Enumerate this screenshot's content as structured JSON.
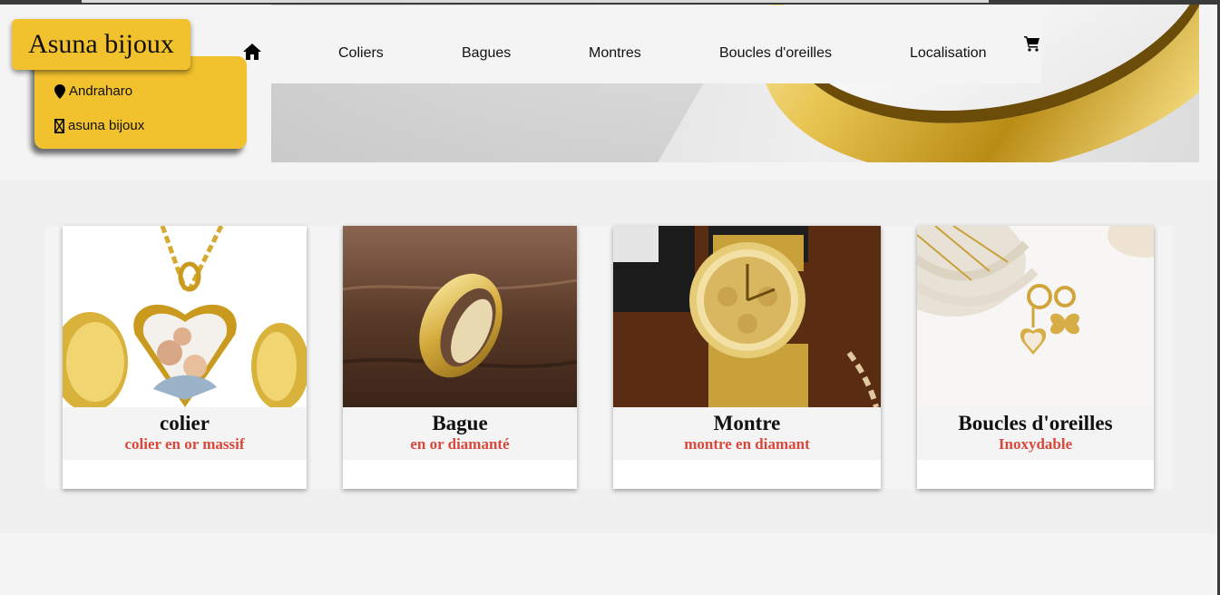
{
  "brand": {
    "name": "Asuna bijoux"
  },
  "info": {
    "location": "Andraharo",
    "social": "asuna bijoux"
  },
  "nav": {
    "items": [
      {
        "label": "Coliers"
      },
      {
        "label": "Bagues"
      },
      {
        "label": "Montres"
      },
      {
        "label": "Boucles d'oreilles"
      },
      {
        "label": "Localisation"
      }
    ]
  },
  "products": [
    {
      "title": "colier",
      "subtitle": "colier en or massif"
    },
    {
      "title": "Bague",
      "subtitle": "en or diamanté"
    },
    {
      "title": "Montre",
      "subtitle": "montre en diamant"
    },
    {
      "title": "Boucles d'oreilles",
      "subtitle": "Inoxydable"
    }
  ],
  "icons": {
    "home": "home-icon",
    "cart": "cart-icon",
    "location": "map-pin-icon",
    "social": "missing-glyph-icon"
  },
  "colors": {
    "brand_yellow": "#f2c12e",
    "accent_red": "#d9483b",
    "gold": "#d4aa30"
  }
}
